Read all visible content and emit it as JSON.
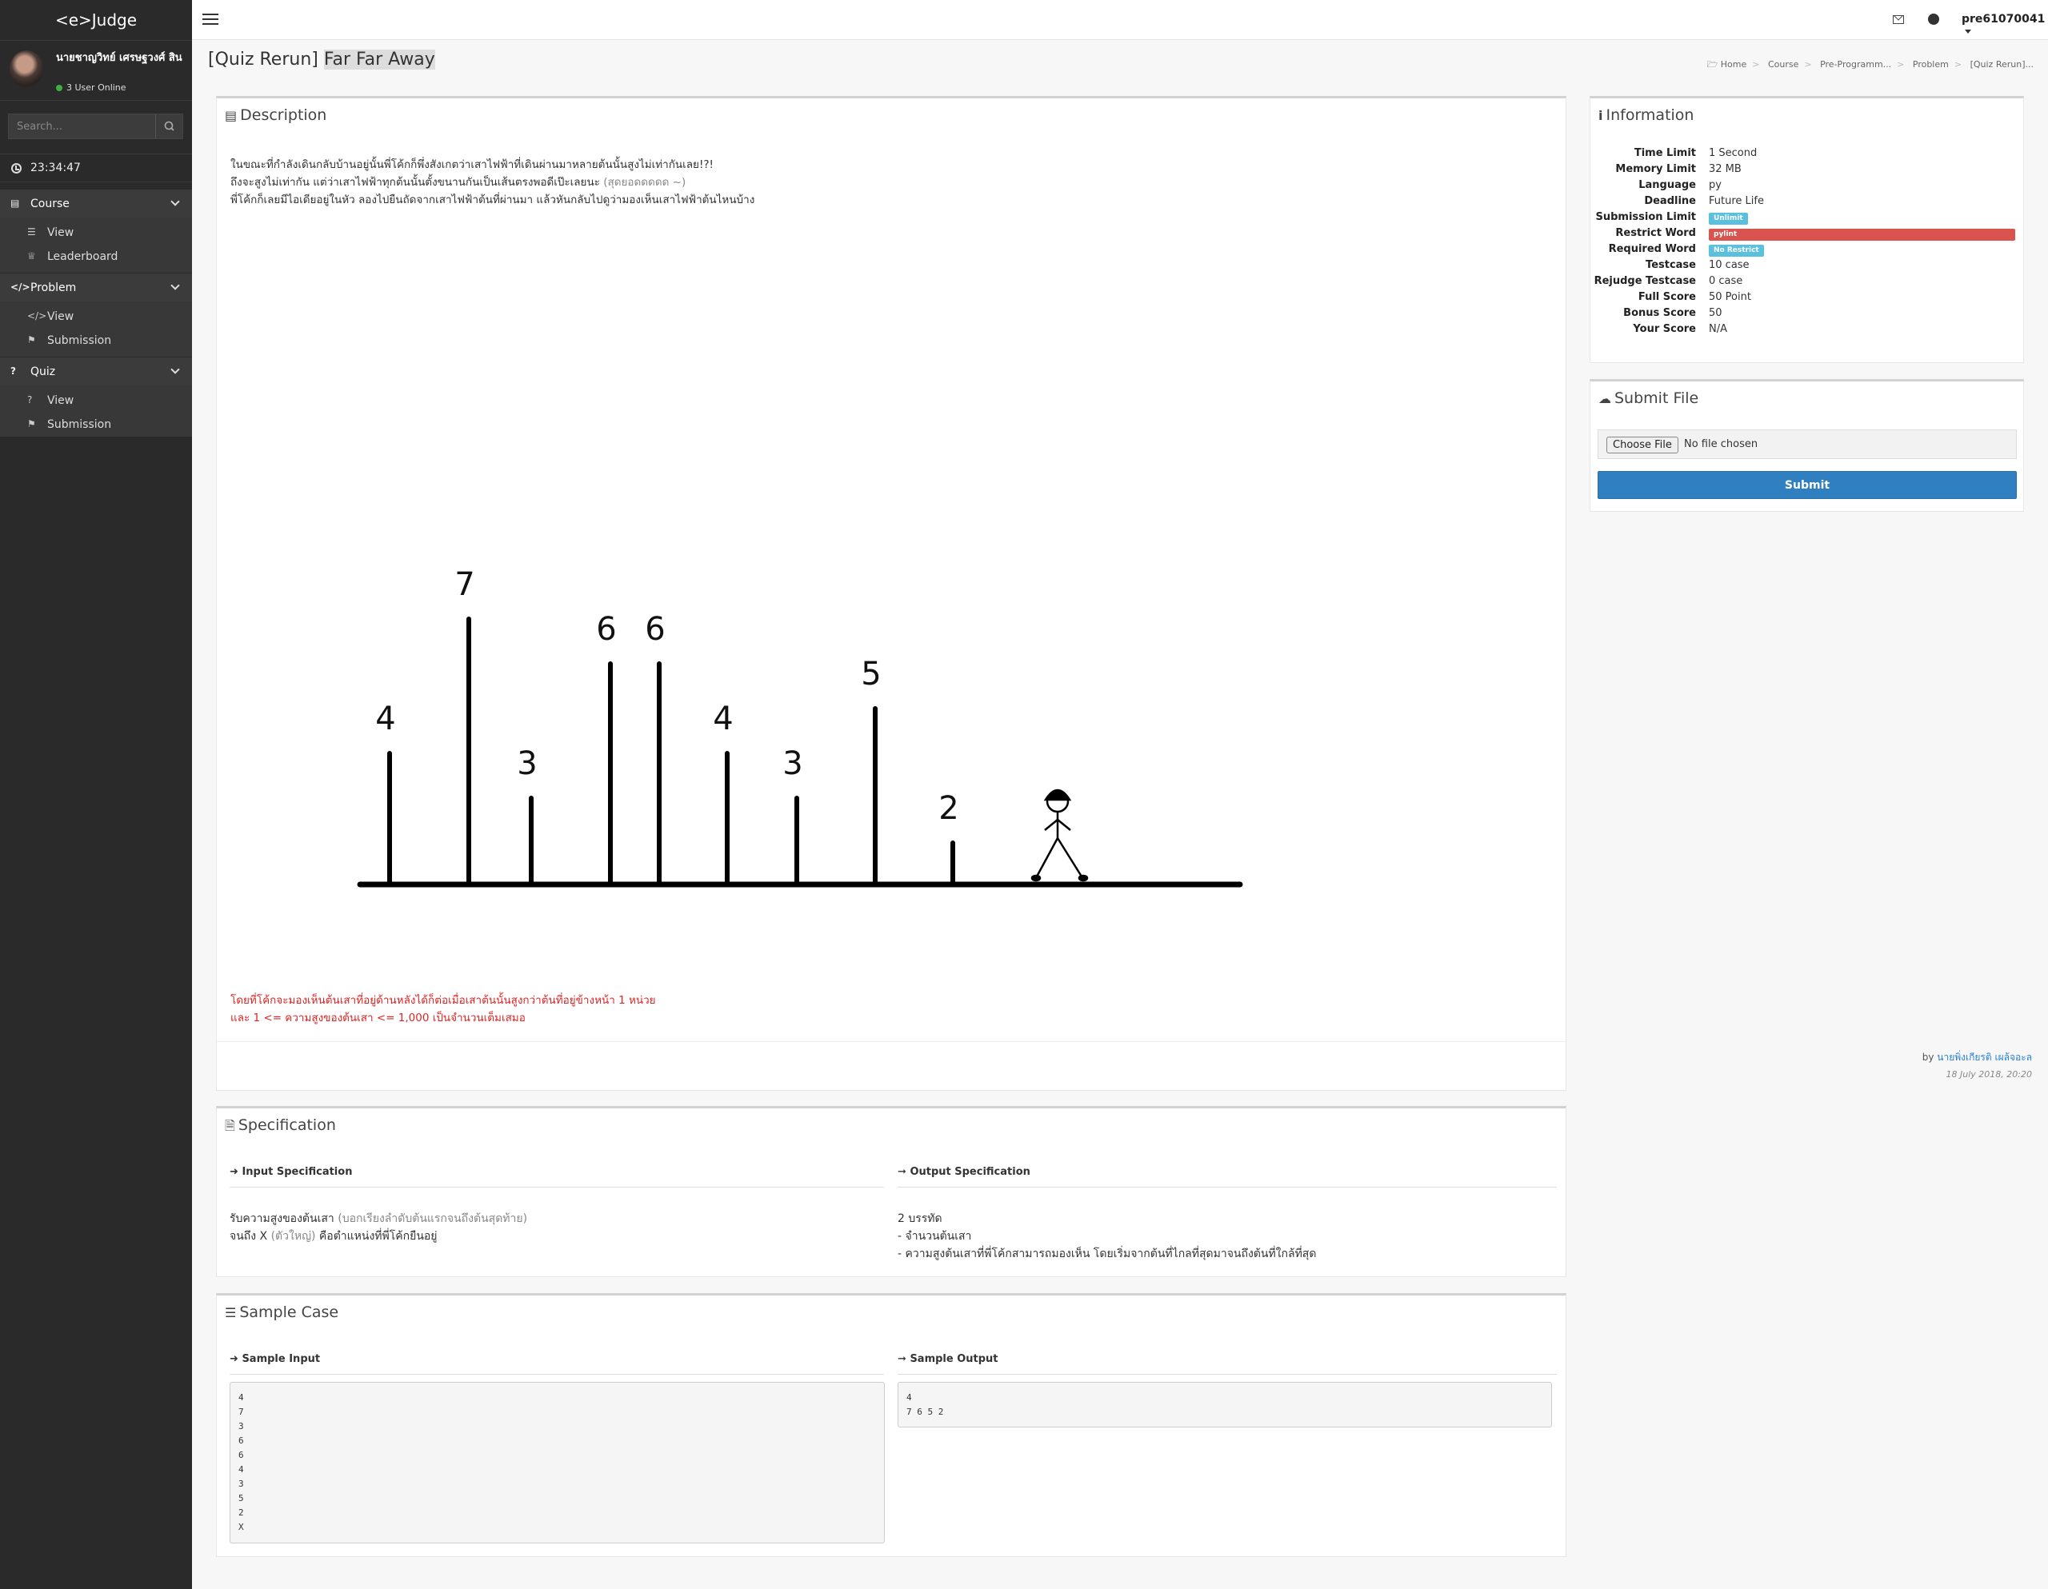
{
  "sidebar": {
    "brand": "<e>Judge",
    "user_name": "นายชาญวิทย์ เศรษฐวงศ์ สิน",
    "online": "3 User Online",
    "search_placeholder": "Search...",
    "clock": "23:34:47",
    "sections": [
      {
        "label": "Course",
        "icon": "book-icon",
        "items": [
          {
            "label": "View",
            "icon": "list-icon"
          },
          {
            "label": "Leaderboard",
            "icon": "trophy-icon"
          }
        ]
      },
      {
        "label": "Problem",
        "icon": "code-icon",
        "items": [
          {
            "label": "View",
            "icon": "code-icon"
          },
          {
            "label": "Submission",
            "icon": "flag-icon"
          }
        ]
      },
      {
        "label": "Quiz",
        "icon": "question-icon",
        "items": [
          {
            "label": "View",
            "icon": "question-icon"
          },
          {
            "label": "Submission",
            "icon": "flag-icon"
          }
        ]
      }
    ]
  },
  "topbar": {
    "user": "pre61070041",
    "icons": [
      "envelope-icon",
      "globe-icon"
    ]
  },
  "page": {
    "title_prefix": "[Quiz Rerun]",
    "title_main": "Far Far Away",
    "breadcrumb": [
      "Home",
      "Course",
      "Pre-Programm...",
      "Problem",
      "[Quiz Rerun]..."
    ]
  },
  "description": {
    "title": "Description",
    "line1": "ในขณะที่กำลังเดินกลับบ้านอยู่นั้นพี่โค้กก็พึ่งสังเกตว่าเสาไฟฟ้าที่เดินผ่านมาหลายต้นนั้นสูงไม่เท่ากันเลย!?!",
    "line2_a": "ถึงจะสูงไม่เท่ากัน แต่ว่าเสาไฟฟ้าทุกต้นนั้นตั้งขนานกันเป็นเส้นตรงพอดีเป๊ะเลยนะ",
    "line2_b": "(สุดยอดดดดด ~)",
    "line3": "พี่โค้กก็เลยมีไอเดียอยู่ในหัว ลองไปยืนถัดจากเสาไฟฟ้าต้นที่ผ่านมา แล้วหันกลับไปดูว่ามองเห็นเสาไฟฟ้าต้นไหนบ้าง",
    "poles": [
      4,
      7,
      3,
      6,
      6,
      4,
      3,
      5,
      2
    ],
    "red_line1": "โดยที่โค้กจะมองเห็นต้นเสาที่อยู่ด้านหลังได้ก็ต่อเมื่อเสาต้นนั้นสูงกว่าต้นที่อยู่ข้างหน้า 1 หน่วย",
    "red_line2": "และ 1 <= ความสูงของต้นเสา <= 1,000  เป็นจำนวนเต็มเสมอ",
    "by": "by",
    "author": "นายพิ่งเกียรติ เผล้จอะล",
    "date": "18 July 2018, 20:20"
  },
  "specification": {
    "title": "Specification",
    "input_head": "Input Specification",
    "output_head": "Output Specification",
    "input_line1_a": "รับความสูงของต้นเสา",
    "input_line1_b": "(บอกเรียงลำดับต้นแรกจนถึงต้นสุดท้าย)",
    "input_line2_a": "จนถึง X",
    "input_line2_b": "(ตัวใหญ่)",
    "input_line2_c": "คือตำแหน่งที่พี่โค้กยืนอยู่",
    "output_line1": "2 บรรทัด",
    "output_line2": "- จำนวนต้นเสา",
    "output_line3": "- ความสูงต้นเสาที่พี่โค้กสามารถมองเห็น โดยเริ่มจากต้นที่ไกลที่สุดมาจนถึงต้นที่ใกล้ที่สุด"
  },
  "sample": {
    "title": "Sample Case",
    "input_head": "Sample Input",
    "output_head": "Sample Output",
    "input": "4\n7\n3\n6\n6\n4\n3\n5\n2\nX",
    "output": "4\n7 6 5 2"
  },
  "information": {
    "title": "Information",
    "rows": [
      {
        "label": "Time Limit",
        "value": "1 Second"
      },
      {
        "label": "Memory Limit",
        "value": "32 MB"
      },
      {
        "label": "Language",
        "value": "py"
      },
      {
        "label": "Deadline",
        "value": "Future Life"
      },
      {
        "label": "Submission Limit",
        "badge": "Unlimit",
        "color": "#5bc0de"
      },
      {
        "label": "Restrict Word",
        "badge": "pylint",
        "color": "#d9534f",
        "full": 1
      },
      {
        "label": "Required Word",
        "badge": "No Restrict",
        "color": "#5bc0de"
      },
      {
        "label": "Testcase",
        "value": "10 case"
      },
      {
        "label": "Rejudge Testcase",
        "value": "0 case"
      },
      {
        "label": "Full Score",
        "value": "50 Point"
      },
      {
        "label": "Bonus Score",
        "value": "50"
      },
      {
        "label": "Your Score",
        "value": "N/A"
      }
    ]
  },
  "submit_file": {
    "title": "Submit File",
    "choose": "Choose File",
    "no_file": "No file chosen",
    "submit": "Submit"
  }
}
